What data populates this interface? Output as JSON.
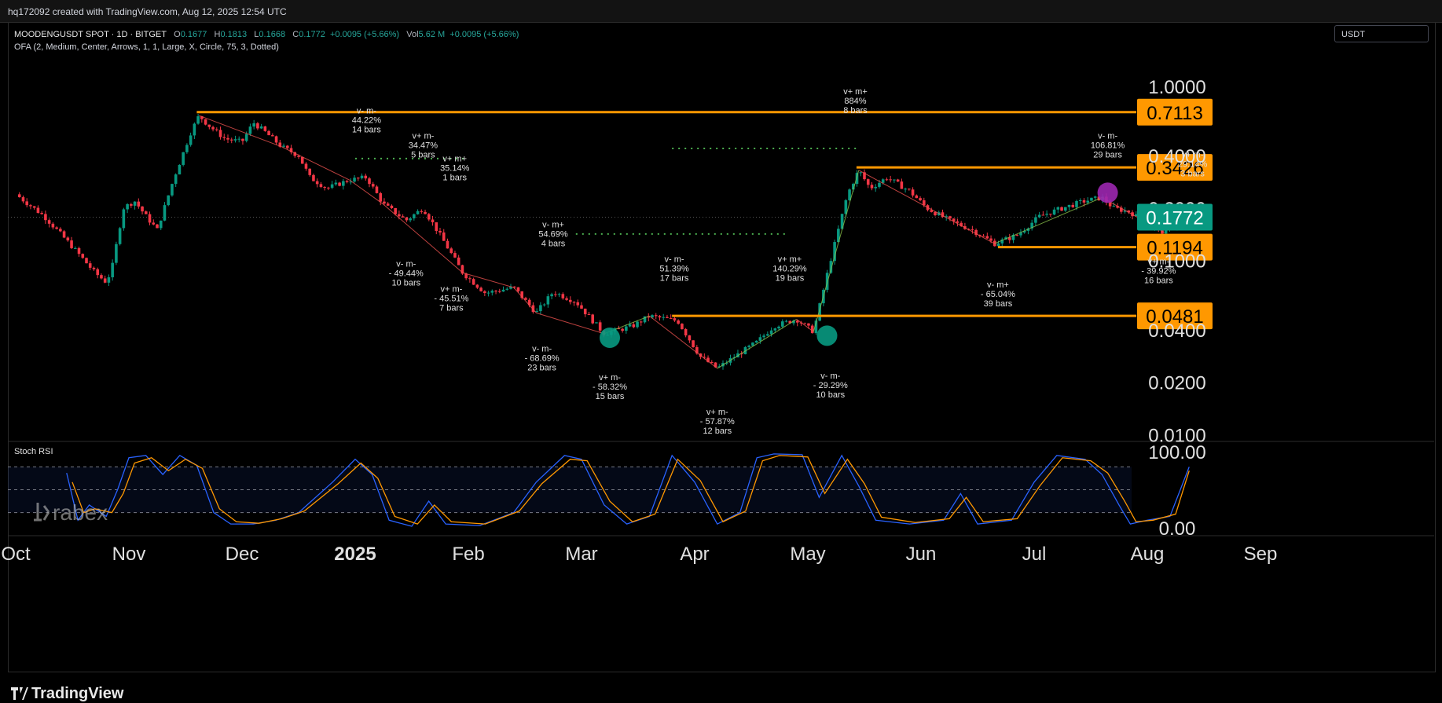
{
  "header": {
    "attribution": "hq172092 created with TradingView.com, Aug 12, 2025 12:54 UTC"
  },
  "legend": {
    "symbol": "MOODENGUSDT SPOT · 1D · BITGET",
    "o_label": "O",
    "o_value": "0.1677",
    "h_label": "H",
    "h_value": "0.1813",
    "l_label": "L",
    "l_value": "0.1668",
    "c_label": "C",
    "c_value": "0.1772",
    "change": "+0.0095 (+5.66%)",
    "vol_label": "Vol",
    "vol_value": "5.62 M",
    "vol_change": "+0.0095 (+5.66%)",
    "indicator": "OFA (2, Medium, Center, Arrows, 1, 1, Large, X, Circle, 75, 3, Dotted)"
  },
  "currency_selector": {
    "value": "USDT"
  },
  "footer": {
    "brand": "TradingView"
  },
  "watermark": {
    "text": "rabex"
  },
  "colors": {
    "level": "#ff9800",
    "up": "#089981",
    "down": "#f23645",
    "current": "#089981",
    "stoch_k": "#2962ff",
    "stoch_d": "#ff9800"
  },
  "chart_data": [
    {
      "type": "candlestick",
      "scale": "log",
      "ylim": [
        0.0085,
        1.15
      ],
      "x_ticks": [
        "Oct",
        "Nov",
        "Dec",
        "2025",
        "Feb",
        "Mar",
        "Apr",
        "May",
        "Jun",
        "Jul",
        "Aug",
        "Sep"
      ],
      "y_ticks": [
        {
          "value": 1.0,
          "label": "1.0000"
        },
        {
          "value": 0.4,
          "label": "0.4000"
        },
        {
          "value": 0.2,
          "label": "0.2000"
        },
        {
          "value": 0.1,
          "label": "0.1000"
        },
        {
          "value": 0.04,
          "label": "0.0400"
        },
        {
          "value": 0.02,
          "label": "0.0200"
        },
        {
          "value": 0.01,
          "label": "0.0100"
        }
      ],
      "levels": [
        {
          "price": 0.7113,
          "label": "0.7113",
          "from_month": 1.6
        },
        {
          "price": 0.3426,
          "label": "0.3426",
          "from_month": 7.43
        },
        {
          "price": 0.1194,
          "label": "0.1194",
          "from_month": 8.68
        },
        {
          "price": 0.0481,
          "label": "0.0481",
          "from_month": 5.8
        }
      ],
      "current_price": {
        "value": 0.1772,
        "label": "0.1772"
      },
      "price_path": [
        [
          0.0,
          0.24
        ],
        [
          0.25,
          0.18
        ],
        [
          0.5,
          0.12
        ],
        [
          0.7,
          0.085
        ],
        [
          0.8,
          0.075
        ],
        [
          0.85,
          0.09
        ],
        [
          0.95,
          0.2
        ],
        [
          1.05,
          0.22
        ],
        [
          1.15,
          0.18
        ],
        [
          1.25,
          0.15
        ],
        [
          1.4,
          0.3
        ],
        [
          1.55,
          0.55
        ],
        [
          1.62,
          0.68
        ],
        [
          1.7,
          0.6
        ],
        [
          1.85,
          0.5
        ],
        [
          2.0,
          0.48
        ],
        [
          2.1,
          0.62
        ],
        [
          2.2,
          0.55
        ],
        [
          2.35,
          0.45
        ],
        [
          2.5,
          0.4
        ],
        [
          2.6,
          0.3
        ],
        [
          2.75,
          0.26
        ],
        [
          2.95,
          0.29
        ],
        [
          3.1,
          0.3
        ],
        [
          3.25,
          0.21
        ],
        [
          3.45,
          0.17
        ],
        [
          3.6,
          0.2
        ],
        [
          3.75,
          0.14
        ],
        [
          3.95,
          0.085
        ],
        [
          4.15,
          0.065
        ],
        [
          4.4,
          0.07
        ],
        [
          4.6,
          0.05
        ],
        [
          4.75,
          0.066
        ],
        [
          4.95,
          0.058
        ],
        [
          5.2,
          0.038
        ],
        [
          5.45,
          0.042
        ],
        [
          5.6,
          0.048
        ],
        [
          5.85,
          0.045
        ],
        [
          6.05,
          0.028
        ],
        [
          6.2,
          0.024
        ],
        [
          6.35,
          0.028
        ],
        [
          6.55,
          0.034
        ],
        [
          6.7,
          0.042
        ],
        [
          6.9,
          0.046
        ],
        [
          7.05,
          0.039
        ],
        [
          7.2,
          0.1
        ],
        [
          7.35,
          0.24
        ],
        [
          7.45,
          0.33
        ],
        [
          7.55,
          0.26
        ],
        [
          7.7,
          0.3
        ],
        [
          7.9,
          0.25
        ],
        [
          8.05,
          0.2
        ],
        [
          8.25,
          0.17
        ],
        [
          8.45,
          0.15
        ],
        [
          8.65,
          0.125
        ],
        [
          8.85,
          0.14
        ],
        [
          9.05,
          0.18
        ],
        [
          9.25,
          0.2
        ],
        [
          9.45,
          0.22
        ],
        [
          9.6,
          0.23
        ],
        [
          9.7,
          0.2
        ],
        [
          9.85,
          0.19
        ],
        [
          10.0,
          0.16
        ],
        [
          10.15,
          0.145
        ],
        [
          10.3,
          0.17
        ],
        [
          10.37,
          0.1772
        ]
      ],
      "markers": [
        {
          "type": "circle",
          "color": "#089981",
          "month": 5.25,
          "price": 0.036
        },
        {
          "type": "circle",
          "color": "#089981",
          "month": 7.17,
          "price": 0.037
        },
        {
          "type": "circle",
          "color": "#9c27b0",
          "month": 9.65,
          "price": 0.245
        }
      ],
      "annotations": [
        {
          "lines": [
            "v- m-",
            "44.22%",
            "14 bars"
          ],
          "month": 3.1,
          "price": 0.7
        },
        {
          "lines": [
            "v+ m-",
            "34.47%",
            "5 bars"
          ],
          "month": 3.6,
          "price": 0.5
        },
        {
          "lines": [
            "v+ m+",
            "35.14%",
            "1 bars"
          ],
          "month": 3.88,
          "price": 0.37
        },
        {
          "lines": [
            "v- m+",
            "54.69%",
            "4 bars"
          ],
          "month": 4.75,
          "price": 0.155
        },
        {
          "lines": [
            "v- m-",
            "- 49.44%",
            "10 bars"
          ],
          "month": 3.45,
          "price": 0.092
        },
        {
          "lines": [
            "v+ m-",
            "- 45.51%",
            "7 bars"
          ],
          "month": 3.85,
          "price": 0.066
        },
        {
          "lines": [
            "v- m-",
            "51.39%",
            "17 bars"
          ],
          "month": 5.82,
          "price": 0.098
        },
        {
          "lines": [
            "v+ m+",
            "140.29%",
            "19 bars"
          ],
          "month": 6.84,
          "price": 0.098
        },
        {
          "lines": [
            "v- m-",
            "- 68.69%",
            "23 bars"
          ],
          "month": 4.65,
          "price": 0.03
        },
        {
          "lines": [
            "v+ m-",
            "- 58.32%",
            "15 bars"
          ],
          "month": 5.25,
          "price": 0.0205
        },
        {
          "lines": [
            "v+ m-",
            "- 57.87%",
            "12 bars"
          ],
          "month": 6.2,
          "price": 0.013
        },
        {
          "lines": [
            "v- m-",
            "- 29.29%",
            "10 bars"
          ],
          "month": 7.2,
          "price": 0.021
        },
        {
          "lines": [
            "v+ m+",
            "884%",
            "8 bars"
          ],
          "month": 7.42,
          "price": 0.9
        },
        {
          "lines": [
            "v- m-",
            "106.81%",
            "29 bars"
          ],
          "month": 9.65,
          "price": 0.5
        },
        {
          "lines": [
            "v+ m-",
            "29.14%",
            "3 bars"
          ],
          "month": 10.4,
          "price": 0.39
        },
        {
          "lines": [
            "v- m+",
            "- 65.04%",
            "39 bars"
          ],
          "month": 8.68,
          "price": 0.07
        },
        {
          "lines": [
            "v+ m-",
            "- 39.92%",
            "16 bars"
          ],
          "month": 10.1,
          "price": 0.095
        }
      ],
      "dotted_levels": [
        {
          "price": 0.385,
          "from_month": 3.0,
          "to_month": 4.0
        },
        {
          "price": 0.44,
          "from_month": 5.8,
          "to_month": 7.45
        },
        {
          "price": 0.142,
          "from_month": 4.95,
          "to_month": 6.8
        }
      ]
    },
    {
      "type": "line",
      "title": "Stoch RSI",
      "ylim": [
        0,
        100
      ],
      "y_ticks": [
        {
          "value": 100,
          "label": "100.00"
        },
        {
          "value": 0,
          "label": "0.00"
        }
      ],
      "bands": [
        80,
        50,
        20
      ],
      "series": [
        {
          "key": "k",
          "color": "#2962ff",
          "values": [
            [
              0.45,
              72
            ],
            [
              0.55,
              10
            ],
            [
              0.65,
              30
            ],
            [
              0.8,
              15
            ],
            [
              0.9,
              50
            ],
            [
              1.0,
              92
            ],
            [
              1.15,
              95
            ],
            [
              1.3,
              70
            ],
            [
              1.45,
              95
            ],
            [
              1.6,
              82
            ],
            [
              1.75,
              20
            ],
            [
              1.9,
              5
            ],
            [
              2.1,
              5
            ],
            [
              2.3,
              10
            ],
            [
              2.5,
              20
            ],
            [
              2.8,
              60
            ],
            [
              3.0,
              90
            ],
            [
              3.15,
              70
            ],
            [
              3.3,
              10
            ],
            [
              3.5,
              2
            ],
            [
              3.65,
              35
            ],
            [
              3.8,
              5
            ],
            [
              4.1,
              3
            ],
            [
              4.4,
              20
            ],
            [
              4.6,
              60
            ],
            [
              4.85,
              95
            ],
            [
              5.0,
              90
            ],
            [
              5.2,
              30
            ],
            [
              5.4,
              5
            ],
            [
              5.6,
              15
            ],
            [
              5.8,
              95
            ],
            [
              6.0,
              60
            ],
            [
              6.2,
              5
            ],
            [
              6.4,
              20
            ],
            [
              6.55,
              92
            ],
            [
              6.7,
              97
            ],
            [
              6.95,
              96
            ],
            [
              7.1,
              40
            ],
            [
              7.3,
              95
            ],
            [
              7.45,
              55
            ],
            [
              7.6,
              10
            ],
            [
              7.9,
              5
            ],
            [
              8.2,
              10
            ],
            [
              8.35,
              45
            ],
            [
              8.5,
              5
            ],
            [
              8.8,
              10
            ],
            [
              9.0,
              60
            ],
            [
              9.2,
              95
            ],
            [
              9.45,
              90
            ],
            [
              9.6,
              70
            ],
            [
              9.75,
              30
            ],
            [
              9.85,
              5
            ],
            [
              10.0,
              10
            ],
            [
              10.2,
              15
            ],
            [
              10.37,
              80
            ]
          ]
        },
        {
          "key": "d",
          "color": "#ff9800",
          "values": [
            [
              0.5,
              60
            ],
            [
              0.6,
              20
            ],
            [
              0.7,
              25
            ],
            [
              0.85,
              20
            ],
            [
              0.95,
              45
            ],
            [
              1.05,
              85
            ],
            [
              1.2,
              92
            ],
            [
              1.35,
              75
            ],
            [
              1.5,
              90
            ],
            [
              1.65,
              78
            ],
            [
              1.8,
              25
            ],
            [
              1.95,
              8
            ],
            [
              2.15,
              6
            ],
            [
              2.35,
              12
            ],
            [
              2.55,
              22
            ],
            [
              2.85,
              58
            ],
            [
              3.05,
              85
            ],
            [
              3.2,
              65
            ],
            [
              3.35,
              15
            ],
            [
              3.55,
              5
            ],
            [
              3.7,
              30
            ],
            [
              3.85,
              8
            ],
            [
              4.15,
              5
            ],
            [
              4.45,
              22
            ],
            [
              4.65,
              58
            ],
            [
              4.9,
              90
            ],
            [
              5.05,
              88
            ],
            [
              5.25,
              35
            ],
            [
              5.45,
              8
            ],
            [
              5.65,
              18
            ],
            [
              5.85,
              90
            ],
            [
              6.05,
              62
            ],
            [
              6.25,
              8
            ],
            [
              6.45,
              22
            ],
            [
              6.6,
              88
            ],
            [
              6.75,
              95
            ],
            [
              7.0,
              93
            ],
            [
              7.15,
              45
            ],
            [
              7.35,
              90
            ],
            [
              7.5,
              58
            ],
            [
              7.65,
              14
            ],
            [
              7.95,
              7
            ],
            [
              8.25,
              12
            ],
            [
              8.4,
              40
            ],
            [
              8.55,
              8
            ],
            [
              8.85,
              12
            ],
            [
              9.05,
              55
            ],
            [
              9.25,
              92
            ],
            [
              9.5,
              88
            ],
            [
              9.65,
              72
            ],
            [
              9.8,
              35
            ],
            [
              9.9,
              8
            ],
            [
              10.05,
              10
            ],
            [
              10.25,
              18
            ],
            [
              10.37,
              75
            ]
          ]
        }
      ]
    }
  ]
}
